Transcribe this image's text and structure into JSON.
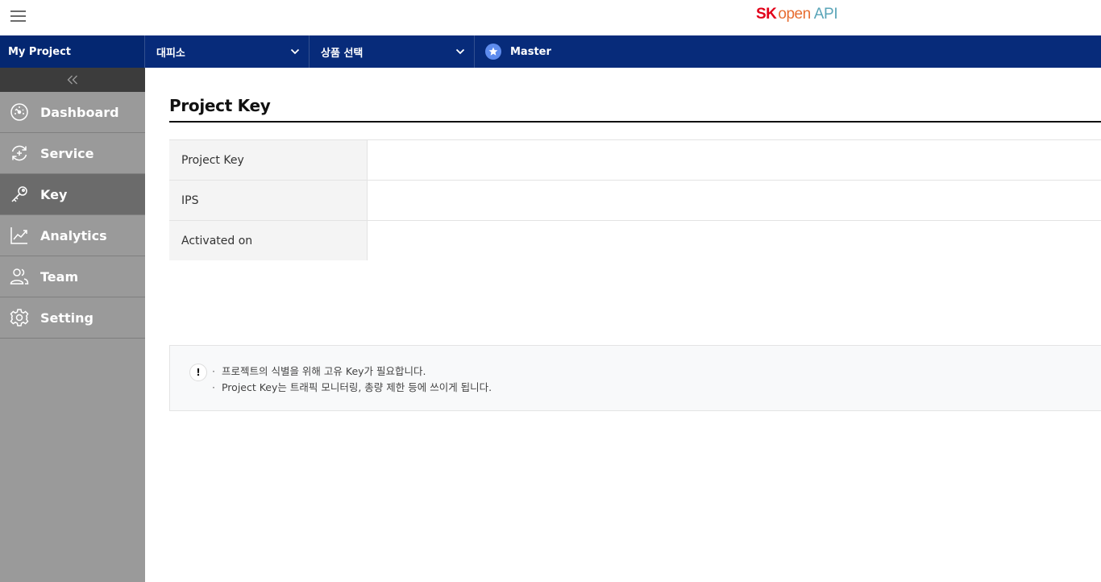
{
  "header": {
    "menu_icon": "hamburger-menu-icon",
    "logo": {
      "sk": "SK",
      "open": "open",
      "api": "API"
    }
  },
  "navbar": {
    "project_label": "My Project",
    "select_1": {
      "value": "대피소",
      "icon": "chevron-down-icon"
    },
    "select_2": {
      "value": "상품 선택",
      "icon": "chevron-down-icon"
    },
    "role": {
      "label": "Master",
      "icon": "star-icon",
      "badge_color": "#5e8cee"
    },
    "color": "#072b7a"
  },
  "sidebar": {
    "collapse_icon": "double-chevron-left-icon",
    "items": [
      {
        "label": "Dashboard",
        "icon": "gauge-icon",
        "active": false
      },
      {
        "label": "Service",
        "icon": "service-cycle-icon",
        "active": false
      },
      {
        "label": "Key",
        "icon": "key-icon",
        "active": true
      },
      {
        "label": "Analytics",
        "icon": "line-chart-icon",
        "active": false
      },
      {
        "label": "Team",
        "icon": "team-users-icon",
        "active": false
      },
      {
        "label": "Setting",
        "icon": "gear-icon",
        "active": false
      }
    ]
  },
  "main": {
    "title": "Project Key",
    "rows": [
      {
        "label": "Project Key",
        "value": ""
      },
      {
        "label": "IPS",
        "value": ""
      },
      {
        "label": "Activated on",
        "value": ""
      }
    ],
    "notice": {
      "icon": "exclamation-icon",
      "mark": "!",
      "lines": [
        "프로젝트의 식별을 위해 고유 Key가 필요합니다.",
        "Project Key는 트래픽 모니터링, 총량 제한 등에 쓰이게 됩니다."
      ]
    }
  }
}
